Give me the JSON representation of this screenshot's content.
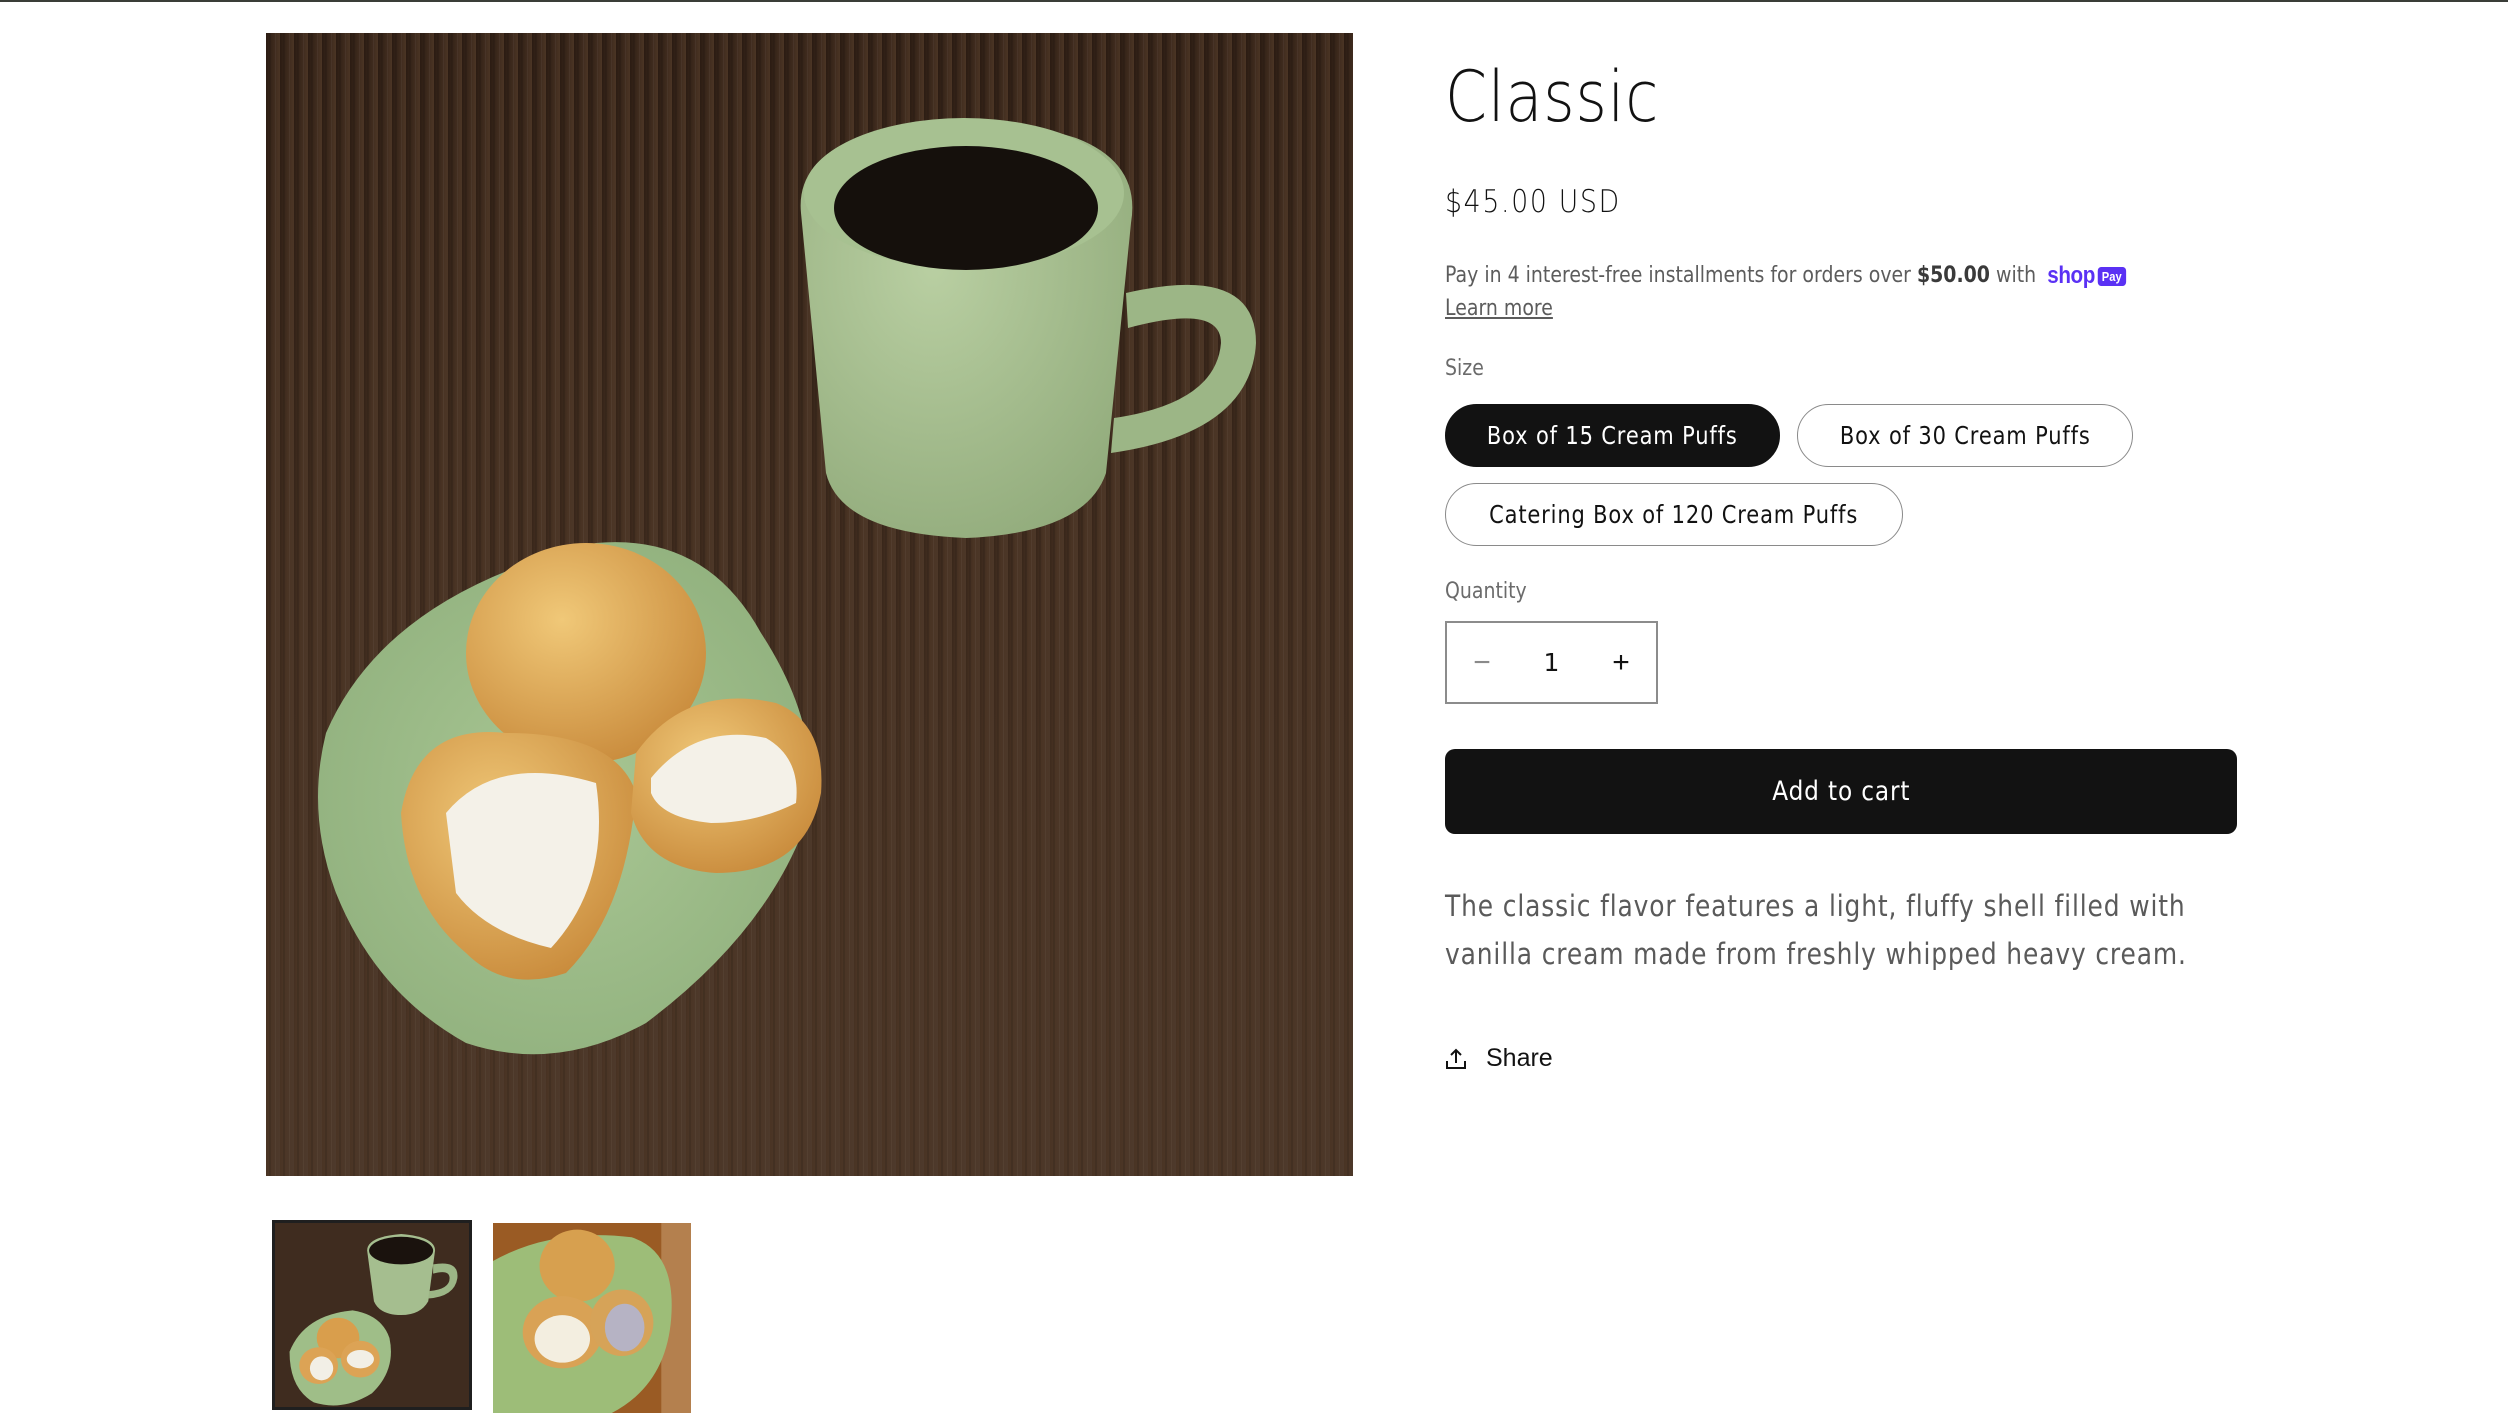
{
  "product": {
    "title": "Classic",
    "price": "$45.00 USD",
    "installments": {
      "prefix": "Pay in 4 interest-free installments for orders over ",
      "threshold": "$50.00",
      "suffix": " with",
      "provider_word": "shop",
      "provider_badge": "Pay",
      "learn_more": "Learn more"
    },
    "size": {
      "label": "Size",
      "options": [
        {
          "label": "Box of 15 Cream Puffs",
          "selected": true
        },
        {
          "label": "Box of 30 Cream Puffs",
          "selected": false
        },
        {
          "label": "Catering Box of 120 Cream Puffs",
          "selected": false
        }
      ]
    },
    "quantity": {
      "label": "Quantity",
      "value": "1",
      "decrease_symbol": "−",
      "increase_symbol": "+"
    },
    "add_to_cart": "Add to cart",
    "description": "The classic flavor features a light, fluffy shell filled with vanilla cream made from freshly whipped heavy cream.",
    "share": "Share"
  },
  "gallery": {
    "main_image": "coffee-mug-and-cream-puffs-photo",
    "thumbnails": [
      {
        "image": "coffee-mug-and-cream-puffs-thumbnail",
        "active": true
      },
      {
        "image": "cream-puffs-on-green-plate-thumbnail",
        "active": false
      }
    ]
  },
  "colors": {
    "accent": "#121212",
    "shop_pay": "#5a31f4",
    "text_muted": "#5c5c5c"
  }
}
